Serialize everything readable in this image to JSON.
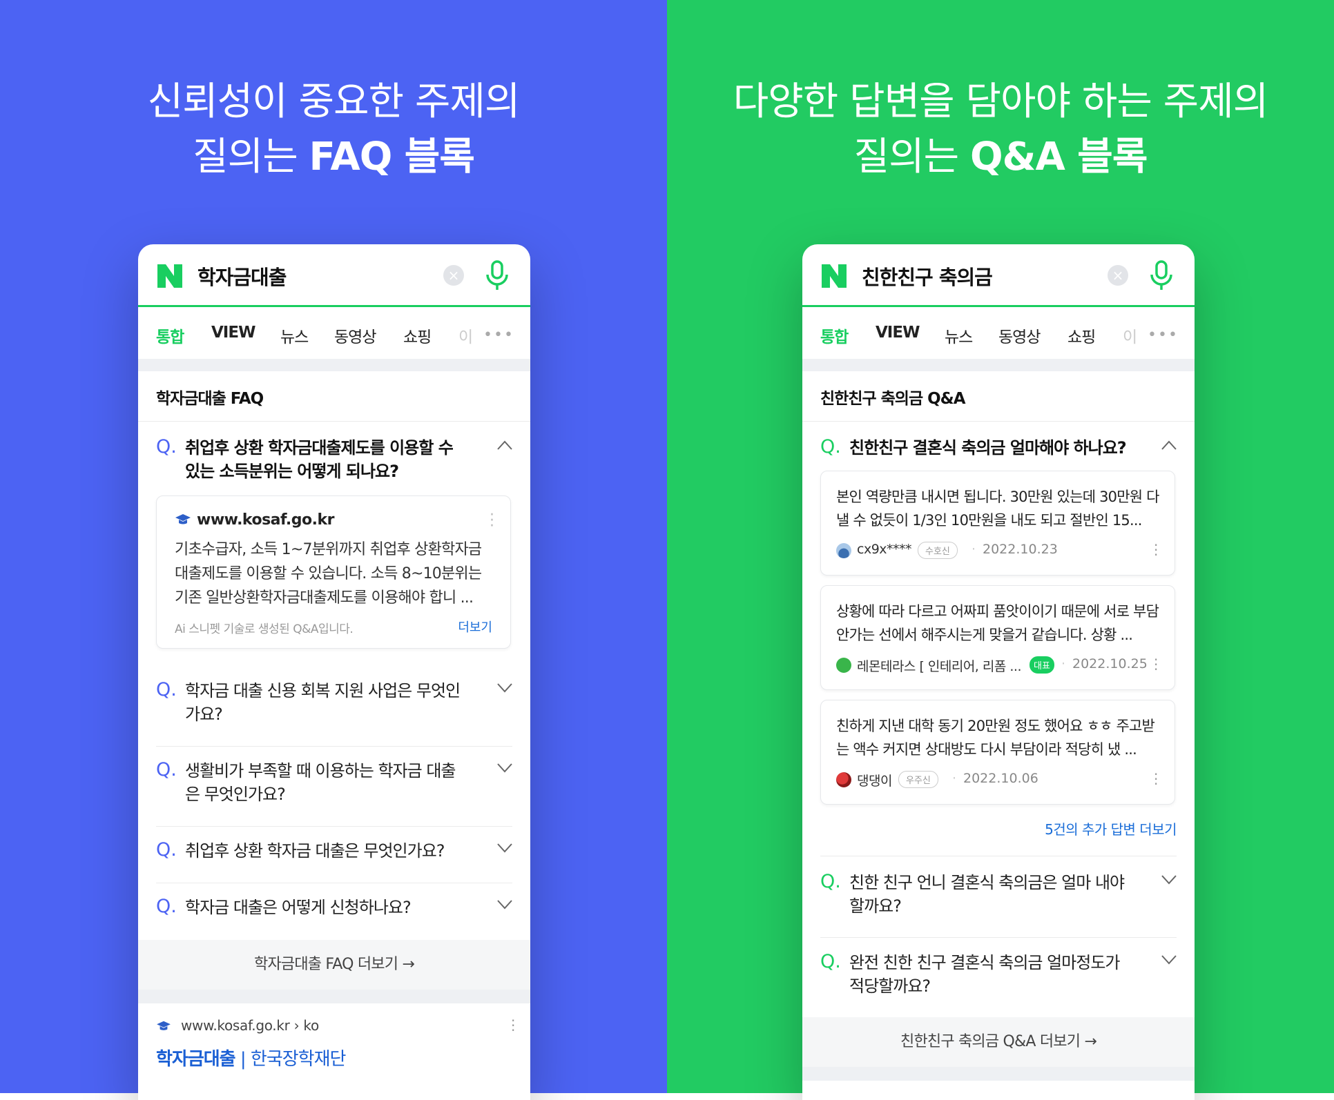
{
  "left": {
    "headline_line1": "신뢰성이 중요한 주제의",
    "headline_line2_prefix": "질의는 ",
    "headline_line2_bold": "FAQ 블록",
    "query": "학자금대출",
    "tabs": [
      "통합",
      "VIEW",
      "뉴스",
      "동영상",
      "쇼핑",
      "이"
    ],
    "block_title": "학자금대출 FAQ",
    "q_mark": "Q.",
    "open_question": "취업후 상환 학자금대출제도를 이용할 수 있는 소득분위는 어떻게 되나요?",
    "card": {
      "site": "www.kosaf.go.kr",
      "body": "기초수급자, 소득 1~7분위까지 취업후 상환학자금대출제도를 이용할 수 있습니다. 소득 8~10분위는 기존 일반상환학자금대출제도를 이용해야 합니 ...",
      "note": "Ai 스니펫 기술로 생성된 Q&A입니다.",
      "more": "더보기"
    },
    "questions": [
      "학자금 대출 신용 회복 지원 사업은 무엇인가요?",
      "생활비가 부족할 때 이용하는 학자금 대출은 무엇인가요?",
      "취업후 상환 학자금 대출은 무엇인가요?",
      "학자금 대출은 어떻게 신청하나요?"
    ],
    "more_button": "학자금대출 FAQ 더보기 →",
    "result_url": "www.kosaf.go.kr › ko",
    "result_title_bold": "학자금대출",
    "result_title_rest": " | 한국장학재단"
  },
  "right": {
    "headline_line1": "다양한 답변을 담아야 하는 주제의",
    "headline_line2_prefix": "질의는 ",
    "headline_line2_bold": "Q&A 블록",
    "query": "친한친구 축의금",
    "tabs": [
      "통합",
      "VIEW",
      "뉴스",
      "동영상",
      "쇼핑",
      "이"
    ],
    "block_title": "친한친구 축의금 Q&A",
    "q_mark": "Q.",
    "open_question": "친한친구 결혼식 축의금 얼마해야 하나요?",
    "answers": [
      {
        "body": "본인 역량만큼 내시면 됩니다. 30만원 있는데 30만원 다 낼 수 없듯이 1/3인 10만원을 내도 되고 절반인 15...",
        "author": "cx9x****",
        "badge": "수호신",
        "date": "2022.10.23"
      },
      {
        "body": "상황에 따라 다르고 어짜피 품앗이이기 때문에 서로 부담 안가는 선에서 해주시는게 맞을거 같습니다. 상황 ...",
        "author": "레몬테라스 [ 인테리어, 리폼 ...",
        "badge": "대표",
        "date": "2022.10.25"
      },
      {
        "body": "친하게 지낸 대학 동기 20만원 정도 했어요 ㅎㅎ 주고받는 액수 커지면 상대방도 다시 부담이라 적당히 냈 ...",
        "author": "댕댕이",
        "badge": "우주신",
        "date": "2022.10.06"
      }
    ],
    "more_answers": "5건의 추가 답변 더보기",
    "questions": [
      "친한 친구 언니 결혼식 축의금은 얼마 내야할까요?",
      "완전 친한 친구 결혼식 축의금 얼마정도가 적당할까요?"
    ],
    "more_button": "친한친구 축의금 Q&A 더보기 →"
  },
  "colors": {
    "left_bg": "#4C63F3",
    "right_bg": "#22CB62",
    "naver_green": "#19CE60",
    "link_blue": "#1A6DD8"
  }
}
